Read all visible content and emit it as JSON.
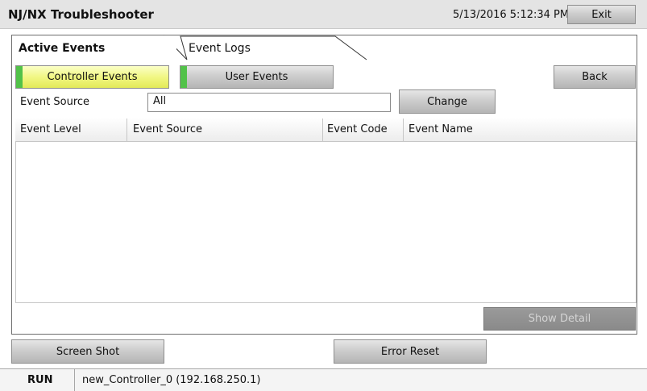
{
  "app": {
    "title": "NJ/NX Troubleshooter",
    "datetime": "5/13/2016 5:12:34 PM",
    "exit_label": "Exit"
  },
  "tabs": [
    {
      "label": "Active Events",
      "active": true
    },
    {
      "label": "Event Logs",
      "active": false
    }
  ],
  "event_buttons": {
    "controller_events": "Controller Events",
    "user_events": "User Events",
    "back": "Back",
    "selected": "controller_events",
    "indicator_color": "#52c249",
    "selected_color": "#f1f784"
  },
  "filter": {
    "label": "Event Source",
    "value": "All",
    "change_label": "Change"
  },
  "table": {
    "columns": [
      "Event Level",
      "Event Source",
      "Event Code",
      "Event Name"
    ],
    "rows": []
  },
  "actions": {
    "show_detail": "Show Detail",
    "show_detail_enabled": false,
    "screen_shot": "Screen Shot",
    "error_reset": "Error Reset"
  },
  "status": {
    "mode": "RUN",
    "controller": "new_Controller_0 (192.168.250.1)"
  }
}
